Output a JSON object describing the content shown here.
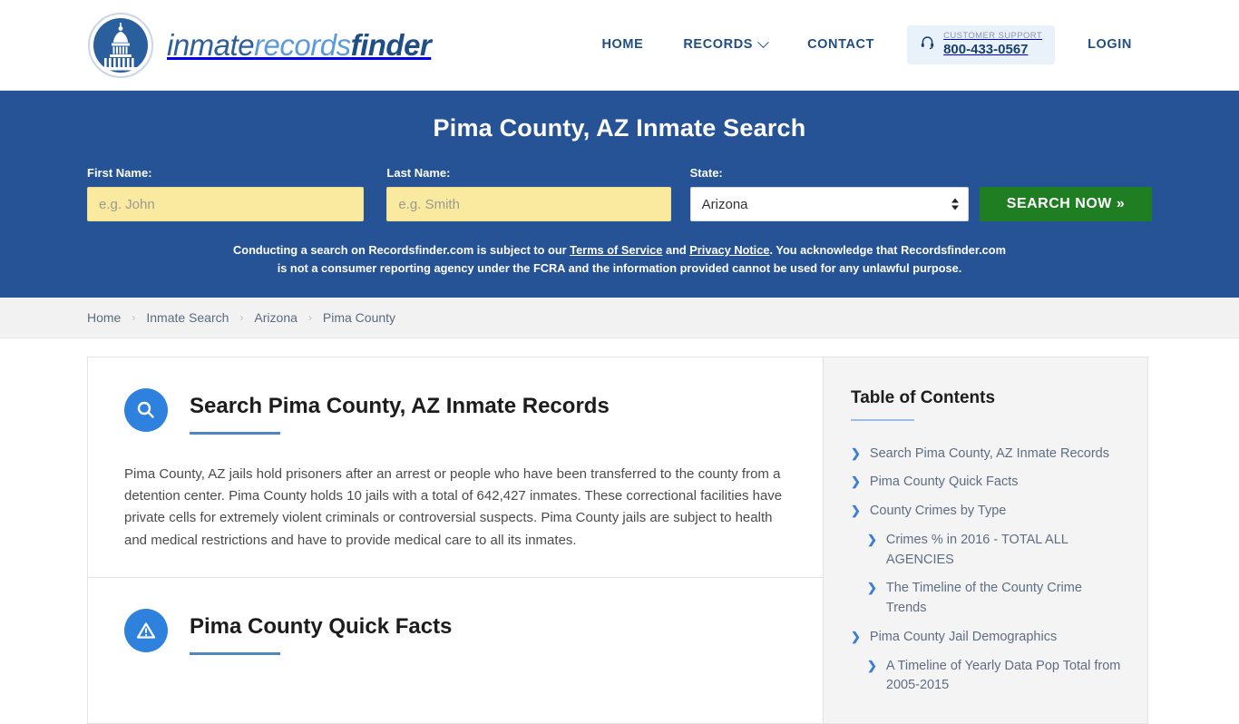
{
  "header": {
    "logo": {
      "part1": "inmate",
      "part2": "records",
      "part3": "finder",
      "icon": "capitol-dome-icon"
    },
    "nav": [
      {
        "label": "HOME",
        "name": "nav-home"
      },
      {
        "label": "RECORDS",
        "name": "nav-records",
        "has_caret": true
      },
      {
        "label": "CONTACT",
        "name": "nav-contact"
      }
    ],
    "support": {
      "label": "CUSTOMER SUPPORT",
      "phone": "800-433-0567",
      "icon": "headset-icon"
    },
    "login": "LOGIN"
  },
  "hero": {
    "title": "Pima County, AZ Inmate Search",
    "first_name_label": "First Name:",
    "first_name_placeholder": "e.g. John",
    "first_name_value": "",
    "last_name_label": "Last Name:",
    "last_name_placeholder": "e.g. Smith",
    "last_name_value": "",
    "state_label": "State:",
    "state_value": "Arizona",
    "search_button": "SEARCH NOW »",
    "disclaimer_1": "Conducting a search on Recordsfinder.com is subject to our ",
    "disclaimer_link1": "Terms of Service",
    "disclaimer_2": " and ",
    "disclaimer_link2": "Privacy Notice",
    "disclaimer_3": ". You acknowledge that Recordsfinder.com is not a consumer reporting agency under the FCRA and the information provided cannot be used for any unlawful purpose."
  },
  "breadcrumb": [
    {
      "label": "Home"
    },
    {
      "label": "Inmate Search"
    },
    {
      "label": "Arizona"
    },
    {
      "label": "Pima County"
    }
  ],
  "main": {
    "sections": [
      {
        "icon": "magnifier-icon",
        "title": "Search Pima County, AZ Inmate Records",
        "body": "Pima County, AZ jails hold prisoners after an arrest or people who have been transferred to the county from a detention center. Pima County holds 10 jails with a total of 642,427 inmates. These correctional facilities have private cells for extremely violent criminals or controversial suspects. Pima County jails are subject to health and medical restrictions and have to provide medical care to all its inmates."
      },
      {
        "icon": "warning-triangle-icon",
        "title": "Pima County Quick Facts",
        "body": ""
      }
    ]
  },
  "sidebar": {
    "title": "Table of Contents",
    "items": [
      {
        "label": "Search Pima County, AZ Inmate Records",
        "level": 1
      },
      {
        "label": "Pima County Quick Facts",
        "level": 1
      },
      {
        "label": "County Crimes by Type",
        "level": 1
      },
      {
        "label": "Crimes % in 2016 - TOTAL ALL AGENCIES",
        "level": 2
      },
      {
        "label": "The Timeline of the County Crime Trends",
        "level": 2
      },
      {
        "label": "Pima County Jail Demographics",
        "level": 1
      },
      {
        "label": "A Timeline of Yearly Data Pop Total from 2005-2015",
        "level": 2
      }
    ]
  },
  "colors": {
    "hero_blue": "#255395",
    "brand_dark": "#1f4e85",
    "brand_light": "#5b9bd9",
    "accent_green": "#1f7d22",
    "input_yellow": "#faeaa0"
  }
}
